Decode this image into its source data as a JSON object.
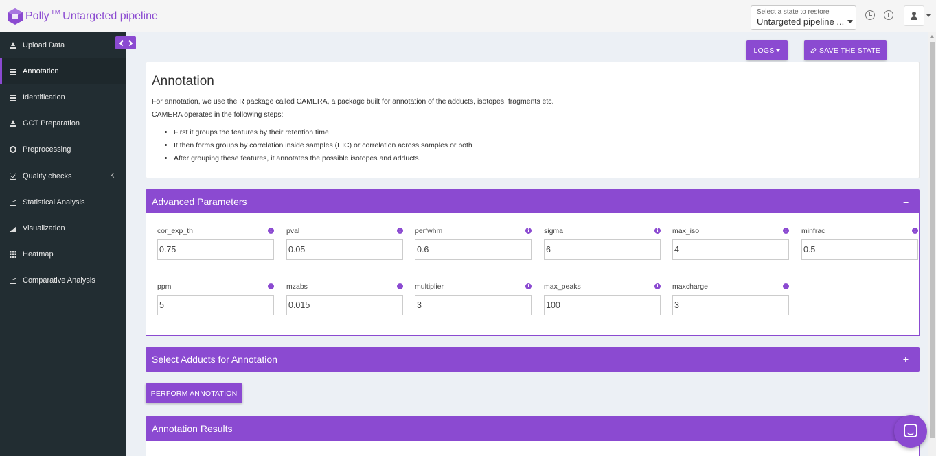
{
  "header": {
    "brand": "Polly",
    "brand_tm": "TM",
    "app_name": "Untargeted pipeline",
    "state_select_label": "Select a state to restore",
    "state_select_value": "Untargeted pipeline ...",
    "icons": [
      "history-icon",
      "info-icon",
      "user-icon"
    ]
  },
  "sidebar": {
    "items": [
      {
        "label": "Upload Data",
        "icon": "upload-icon"
      },
      {
        "label": "Annotation",
        "icon": "bars-icon",
        "active": true
      },
      {
        "label": "Identification",
        "icon": "bars-icon"
      },
      {
        "label": "GCT Preparation",
        "icon": "upload-icon"
      },
      {
        "label": "Preprocessing",
        "icon": "circle-icon"
      },
      {
        "label": "Quality checks",
        "icon": "checkbox-icon"
      },
      {
        "label": "Statistical Analysis",
        "icon": "chart-icon"
      },
      {
        "label": "Visualization",
        "icon": "area-chart-icon"
      },
      {
        "label": "Heatmap",
        "icon": "grid-icon"
      },
      {
        "label": "Comparative Analysis",
        "icon": "chart-icon"
      }
    ]
  },
  "toolbar": {
    "logs_label": "LOGS",
    "save_label": "SAVE THE STATE"
  },
  "annotation": {
    "title": "Annotation",
    "intro": "For annotation, we use the R package called CAMERA, a package built for annotation of the adducts, isotopes, fragments etc.",
    "steps_intro": "CAMERA operates in the following steps:",
    "steps": [
      "First it groups the features by their retention time",
      "It then forms groups by correlation inside samples (EIC) or correlation across samples or both",
      "After grouping these features, it annotates the possible isotopes and adducts."
    ]
  },
  "advanced": {
    "title": "Advanced Parameters",
    "collapse_symbol": "–",
    "params": [
      {
        "label": "cor_exp_th",
        "value": "0.75"
      },
      {
        "label": "pval",
        "value": "0.05"
      },
      {
        "label": "perfwhm",
        "value": "0.6"
      },
      {
        "label": "sigma",
        "value": "6"
      },
      {
        "label": "max_iso",
        "value": "4"
      },
      {
        "label": "minfrac",
        "value": "0.5"
      },
      {
        "label": "ppm",
        "value": "5"
      },
      {
        "label": "mzabs",
        "value": "0.015"
      },
      {
        "label": "multiplier",
        "value": "3"
      },
      {
        "label": "max_peaks",
        "value": "100"
      },
      {
        "label": "maxcharge",
        "value": "3"
      }
    ]
  },
  "adducts": {
    "title": "Select Adducts for Annotation",
    "expand_symbol": "+"
  },
  "perform_label": "PERFORM ANNOTATION",
  "results": {
    "title": "Annotation Results"
  },
  "colors": {
    "accent": "#8b4ad1",
    "sidebar_bg": "#222d32",
    "page_bg": "#ecf0f5"
  }
}
